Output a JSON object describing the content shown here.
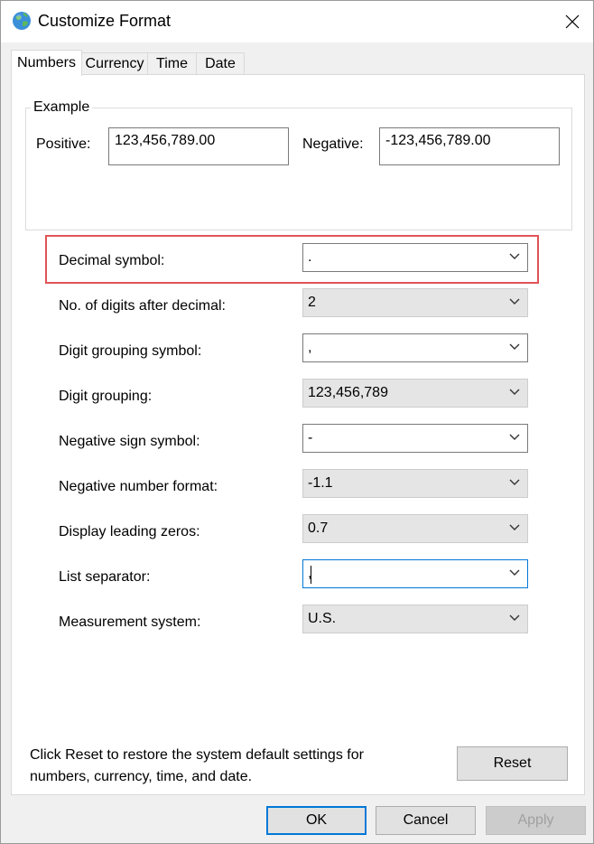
{
  "window": {
    "title": "Customize Format"
  },
  "tabs": [
    {
      "label": "Numbers",
      "active": true
    },
    {
      "label": "Currency",
      "active": false
    },
    {
      "label": "Time",
      "active": false
    },
    {
      "label": "Date",
      "active": false
    }
  ],
  "example": {
    "group_label": "Example",
    "positive_label": "Positive:",
    "positive_value": "123,456,789.00",
    "negative_label": "Negative:",
    "negative_value": "-123,456,789.00"
  },
  "settings": [
    {
      "label": "Decimal symbol:",
      "value": ".",
      "editable": true
    },
    {
      "label": "No. of digits after decimal:",
      "value": "2",
      "editable": false
    },
    {
      "label": "Digit grouping symbol:",
      "value": ",",
      "editable": true
    },
    {
      "label": "Digit grouping:",
      "value": "123,456,789",
      "editable": false
    },
    {
      "label": "Negative sign symbol:",
      "value": "-",
      "editable": true
    },
    {
      "label": "Negative number format:",
      "value": "-1.1",
      "editable": false
    },
    {
      "label": "Display leading zeros:",
      "value": "0.7",
      "editable": false
    },
    {
      "label": "List separator:",
      "value": ",",
      "editable": true,
      "focused": true
    },
    {
      "label": "Measurement system:",
      "value": "U.S.",
      "editable": false
    }
  ],
  "reset": {
    "note_line1": "Click Reset to restore the system default settings for",
    "note_line2": "numbers, currency, time, and date.",
    "button_label": "Reset"
  },
  "footer": {
    "ok_label": "OK",
    "cancel_label": "Cancel",
    "apply_label": "Apply"
  },
  "colors": {
    "highlight": "#e05457",
    "focus": "#0078d7",
    "readonly_bg": "#e5e5e5"
  }
}
